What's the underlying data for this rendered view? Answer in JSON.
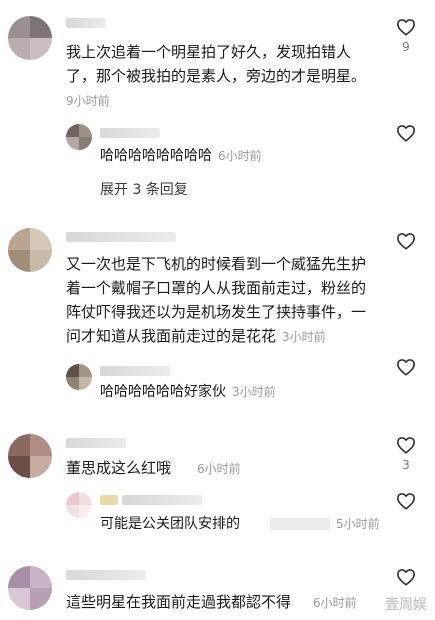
{
  "comments": [
    {
      "text": "我上次追着一个明星拍了好久，发现拍错人了，那个被我拍的是素人，旁边的才是明星。",
      "time": "9小时前",
      "likes": "9",
      "reply": {
        "text": "哈哈哈哈哈哈哈哈",
        "time": "6小时前"
      },
      "expand_label": "展开 3 条回复"
    },
    {
      "text": "又一次也是下飞机的时候看到一个威猛先生护着一个戴帽子口罩的人从我面前走过，粉丝的阵仗吓得我还以为是机场发生了挟持事件，一问才知道从我面前走过的是花花",
      "time": "3小时前",
      "reply": {
        "text": "哈哈哈哈哈哈好家伙",
        "time": "3小时前"
      }
    },
    {
      "text": "董思成这么红哦",
      "time": "6小时前",
      "likes": "3",
      "reply": {
        "text": "可能是公关团队安排的",
        "time": "5小时前"
      }
    },
    {
      "text": "這些明星在我面前走過我都認不得",
      "time": "6小时前"
    }
  ],
  "watermark": "壹周娱",
  "icons": {
    "like": "heart-outline-icon"
  },
  "colors": {
    "text": "#1a1a1a",
    "meta": "#9a9a9a",
    "icon": "#333333"
  }
}
